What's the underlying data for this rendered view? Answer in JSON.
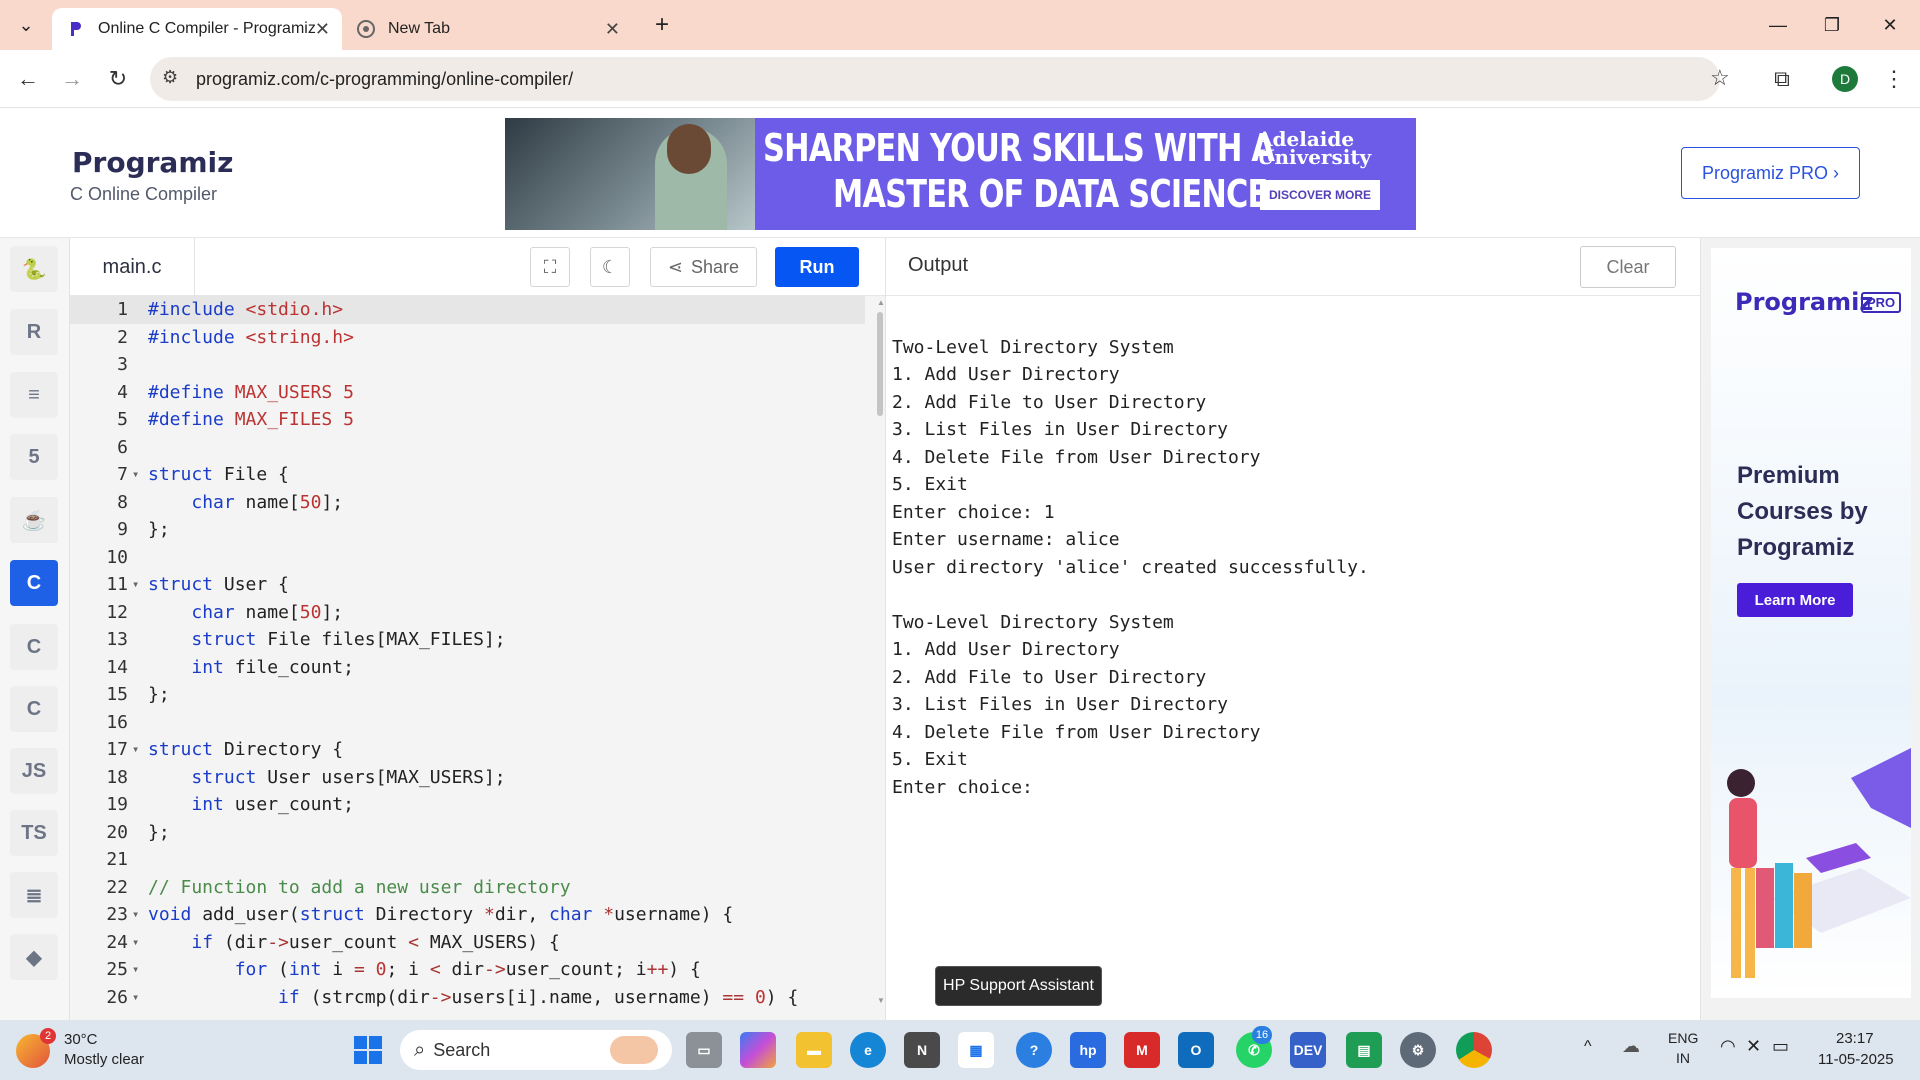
{
  "browser": {
    "tabs": [
      {
        "title": "Online C Compiler - Programiz",
        "active": true
      },
      {
        "title": "New Tab",
        "active": false
      }
    ],
    "url": "programiz.com/c-programming/online-compiler/",
    "profile_initial": "D"
  },
  "site": {
    "logo_text": "Programiz",
    "logo_sub": "C Online Compiler",
    "pro_button": "Programiz PRO ›",
    "ad": {
      "line1": "SHARPEN YOUR SKILLS WITH A",
      "line2": "MASTER OF DATA SCIENCE",
      "university": "Adelaide University",
      "cta": "DISCOVER MORE"
    }
  },
  "rail": {
    "items": [
      {
        "name": "python-icon",
        "glyph": "🐍"
      },
      {
        "name": "r-icon",
        "glyph": "R"
      },
      {
        "name": "sql-icon",
        "glyph": "≡"
      },
      {
        "name": "html-icon",
        "glyph": "5"
      },
      {
        "name": "java-icon",
        "glyph": "☕"
      },
      {
        "name": "c-icon",
        "glyph": "C"
      },
      {
        "name": "cpp-icon",
        "glyph": "C"
      },
      {
        "name": "csharp-icon",
        "glyph": "C"
      },
      {
        "name": "js-icon",
        "glyph": "JS"
      },
      {
        "name": "ts-icon",
        "glyph": "TS"
      },
      {
        "name": "go-icon",
        "glyph": "≣"
      },
      {
        "name": "swift-icon",
        "glyph": "◆"
      }
    ]
  },
  "editor": {
    "filename": "main.c",
    "share_label": "Share",
    "run_label": "Run",
    "lines": [
      {
        "n": "1",
        "fold": "",
        "html": "<span class=\"pp\">#include</span> <span class=\"str\">&lt;stdio.h&gt;</span>"
      },
      {
        "n": "2",
        "fold": "",
        "html": "<span class=\"pp\">#include</span> <span class=\"str\">&lt;string.h&gt;</span>"
      },
      {
        "n": "3",
        "fold": "",
        "html": ""
      },
      {
        "n": "4",
        "fold": "",
        "html": "<span class=\"pp\">#define</span> <span class=\"str\">MAX_USERS 5</span>"
      },
      {
        "n": "5",
        "fold": "",
        "html": "<span class=\"pp\">#define</span> <span class=\"str\">MAX_FILES 5</span>"
      },
      {
        "n": "6",
        "fold": "",
        "html": ""
      },
      {
        "n": "7",
        "fold": "▾",
        "html": "<span class=\"kw\">struct</span> File {"
      },
      {
        "n": "8",
        "fold": "",
        "html": "    <span class=\"kw\">char</span> name[<span class=\"num\">50</span>];"
      },
      {
        "n": "9",
        "fold": "",
        "html": "};"
      },
      {
        "n": "10",
        "fold": "",
        "html": ""
      },
      {
        "n": "11",
        "fold": "▾",
        "html": "<span class=\"kw\">struct</span> User {"
      },
      {
        "n": "12",
        "fold": "",
        "html": "    <span class=\"kw\">char</span> name[<span class=\"num\">50</span>];"
      },
      {
        "n": "13",
        "fold": "",
        "html": "    <span class=\"kw\">struct</span> File files[MAX_FILES];"
      },
      {
        "n": "14",
        "fold": "",
        "html": "    <span class=\"kw\">int</span> file_count;"
      },
      {
        "n": "15",
        "fold": "",
        "html": "};"
      },
      {
        "n": "16",
        "fold": "",
        "html": ""
      },
      {
        "n": "17",
        "fold": "▾",
        "html": "<span class=\"kw\">struct</span> Directory {"
      },
      {
        "n": "18",
        "fold": "",
        "html": "    <span class=\"kw\">struct</span> User users[MAX_USERS];"
      },
      {
        "n": "19",
        "fold": "",
        "html": "    <span class=\"kw\">int</span> user_count;"
      },
      {
        "n": "20",
        "fold": "",
        "html": "};"
      },
      {
        "n": "21",
        "fold": "",
        "html": ""
      },
      {
        "n": "22",
        "fold": "",
        "html": "<span class=\"cm\">// Function to add a new user directory</span>"
      },
      {
        "n": "23",
        "fold": "▾",
        "html": "<span class=\"kw\">void</span> add_user(<span class=\"kw\">struct</span> Directory <span class=\"op\">*</span>dir, <span class=\"kw\">char</span> <span class=\"op\">*</span>username) {"
      },
      {
        "n": "24",
        "fold": "▾",
        "html": "    <span class=\"kw\">if</span> (dir<span class=\"op\">-&gt;</span>user_count <span class=\"op\">&lt;</span> MAX_USERS) {"
      },
      {
        "n": "25",
        "fold": "▾",
        "html": "        <span class=\"kw\">for</span> (<span class=\"kw\">int</span> i <span class=\"op\">=</span> <span class=\"num\">0</span>; i <span class=\"op\">&lt;</span> dir<span class=\"op\">-&gt;</span>user_count; i<span class=\"op\">++</span>) {"
      },
      {
        "n": "26",
        "fold": "▾",
        "html": "            <span class=\"kw\">if</span> (strcmp(dir<span class=\"op\">-&gt;</span>users[i].name, username) <span class=\"op\">==</span> <span class=\"num\">0</span>) {"
      }
    ]
  },
  "output": {
    "title": "Output",
    "clear_label": "Clear",
    "lines": [
      "",
      "Two-Level Directory System",
      "1. Add User Directory",
      "2. Add File to User Directory",
      "3. List Files in User Directory",
      "4. Delete File from User Directory",
      "5. Exit",
      "Enter choice: 1",
      "Enter username: alice",
      "User directory 'alice' created successfully.",
      "",
      "Two-Level Directory System",
      "1. Add User Directory",
      "2. Add File to User Directory",
      "3. List Files in User Directory",
      "4. Delete File from User Directory",
      "5. Exit",
      "Enter choice:"
    ]
  },
  "side_ad": {
    "logo": "Programiz",
    "pro": "PRO",
    "headline": "Premium Courses by Programiz",
    "cta": "Learn More"
  },
  "tooltip": "HP Support Assistant",
  "taskbar": {
    "weather_temp": "30°C",
    "weather_desc": "Mostly clear",
    "weather_badge": "2",
    "search_placeholder": "Search",
    "lang_top": "ENG",
    "lang_bottom": "IN",
    "time": "23:17",
    "date": "11-05-2025",
    "whatsapp_badge": "16"
  }
}
